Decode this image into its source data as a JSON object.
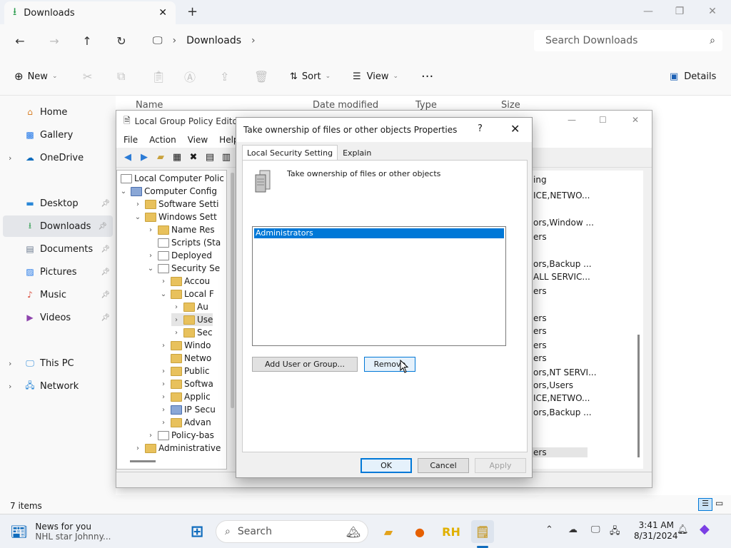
{
  "explorer": {
    "tab_title": "Downloads",
    "breadcrumb": [
      "Downloads"
    ],
    "search_placeholder": "Search Downloads",
    "commands": {
      "new": "New",
      "sort": "Sort",
      "view": "View",
      "details": "Details"
    },
    "columns": [
      "Name",
      "Date modified",
      "Type",
      "Size"
    ],
    "sidebar": [
      {
        "label": "Home",
        "icon": "home-icon"
      },
      {
        "label": "Gallery",
        "icon": "gallery-icon"
      },
      {
        "label": "OneDrive",
        "icon": "cloud-icon"
      },
      {
        "label": "Desktop",
        "icon": "desktop-icon"
      },
      {
        "label": "Downloads",
        "icon": "download-icon"
      },
      {
        "label": "Documents",
        "icon": "documents-icon"
      },
      {
        "label": "Pictures",
        "icon": "pictures-icon"
      },
      {
        "label": "Music",
        "icon": "music-icon"
      },
      {
        "label": "Videos",
        "icon": "videos-icon"
      },
      {
        "label": "This PC",
        "icon": "pc-icon"
      },
      {
        "label": "Network",
        "icon": "network-icon"
      }
    ],
    "status": "7 items"
  },
  "gpedit": {
    "title": "Local Group Policy Editor",
    "menu": [
      "File",
      "Action",
      "View",
      "Help"
    ],
    "tree": [
      "Local Computer Polic",
      "Computer Config",
      "Software Setti",
      "Windows Sett",
      "Name Res",
      "Scripts (Sta",
      "Deployed",
      "Security Se",
      "Accou",
      "Local F",
      "Au",
      "Use",
      "Sec",
      "Windo",
      "Netwo",
      "Public",
      "Softwa",
      "Applic",
      "IP Secu",
      "Advan",
      "Policy-bas",
      "Administrative"
    ],
    "right_column": [
      "ing",
      "ICE,NETWO...",
      "ors,Window ...",
      "ers",
      "ors,Backup ...",
      "ALL SERVIC...",
      "ers",
      "ers",
      "ers",
      "ers",
      "ers",
      "ors,NT SERVI...",
      "ors,Users",
      "ICE,NETWO...",
      "ors,Backup ...",
      "ers"
    ]
  },
  "dialog": {
    "title": "Take ownership of files or other objects Properties",
    "help": "?",
    "tabs": [
      "Local Security Setting",
      "Explain"
    ],
    "policy_name": "Take ownership of files or other objects",
    "list_items": [
      "Administrators"
    ],
    "add_button": "Add User or Group...",
    "remove_button": "Remove",
    "ok": "OK",
    "cancel": "Cancel",
    "apply": "Apply"
  },
  "taskbar": {
    "news_title": "News for you",
    "news_sub": "NHL star Johnny...",
    "search_placeholder": "Search",
    "time": "3:41 AM",
    "date": "8/31/2024"
  }
}
